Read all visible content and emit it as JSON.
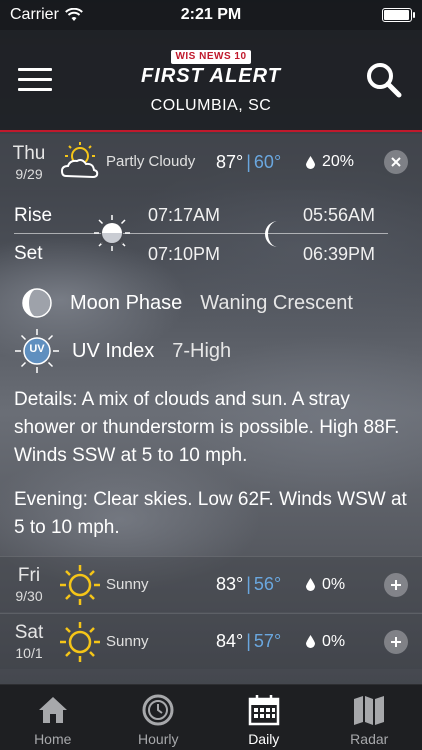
{
  "status_bar": {
    "carrier": "Carrier",
    "time": "2:21 PM"
  },
  "header": {
    "badge": "WIS NEWS 10",
    "brand": "FIRST ALERT",
    "location": "COLUMBIA, SC"
  },
  "today": {
    "dow": "Thu",
    "date": "9/29",
    "condition": "Partly Cloudy",
    "icon": "partly-cloudy-icon",
    "high": "87°",
    "low": "60°",
    "precip": "20%"
  },
  "sun_moon": {
    "rise_label": "Rise",
    "set_label": "Set",
    "sunrise": "07:17AM",
    "sunset": "07:10PM",
    "moonrise": "05:56AM",
    "moonset": "06:39PM"
  },
  "moon_phase": {
    "label": "Moon Phase",
    "value": "Waning Crescent"
  },
  "uv_index": {
    "icon_text": "UV",
    "label": "UV Index",
    "value": "7-High"
  },
  "details": {
    "day": "Details: A mix of clouds and sun. A stray shower or thunderstorm is possible. High 88F. Winds SSW at 5 to 10 mph.",
    "evening": "Evening: Clear skies. Low 62F. Winds WSW at 5 to 10 mph."
  },
  "forecast": [
    {
      "dow": "Fri",
      "date": "9/30",
      "condition": "Sunny",
      "icon": "sun-icon",
      "high": "83°",
      "low": "56°",
      "precip": "0%"
    },
    {
      "dow": "Sat",
      "date": "10/1",
      "condition": "Sunny",
      "icon": "sun-icon",
      "high": "84°",
      "low": "57°",
      "precip": "0%"
    }
  ],
  "tabs": [
    {
      "label": "Home",
      "icon": "home-icon"
    },
    {
      "label": "Hourly",
      "icon": "clock-icon"
    },
    {
      "label": "Daily",
      "icon": "calendar-icon",
      "active": true
    },
    {
      "label": "Radar",
      "icon": "map-icon"
    }
  ],
  "colors": {
    "accent_red": "#c0192c",
    "low_temp": "#6aa7df",
    "sun": "#f5c518"
  },
  "battery_level": 1.0
}
